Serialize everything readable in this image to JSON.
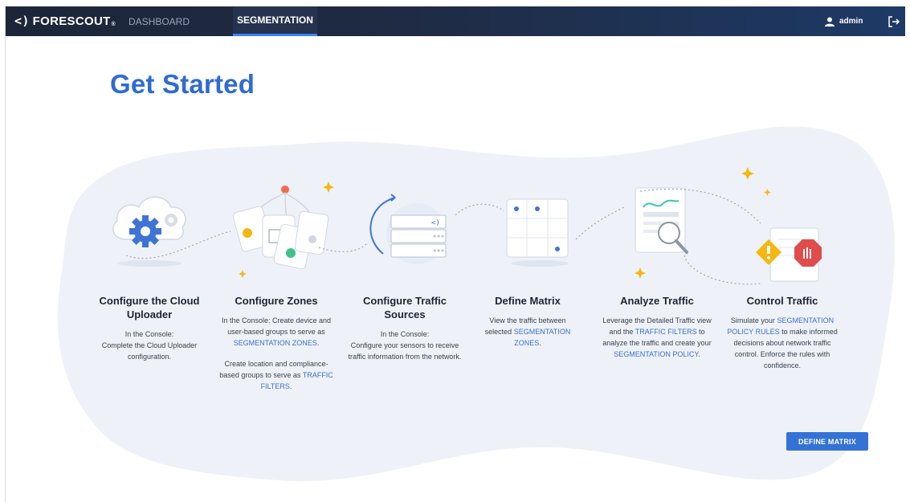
{
  "header": {
    "logo_mark": "<)",
    "logo_text": "FORESCOUT",
    "logo_reg": "®",
    "tabs": [
      {
        "label": "DASHBOARD",
        "active": false
      },
      {
        "label": "SEGMENTATION",
        "active": true
      }
    ],
    "user": "admin"
  },
  "page": {
    "title": "Get Started"
  },
  "steps": [
    {
      "title": "Configure the Cloud Uploader",
      "text1": "In the Console:",
      "text2": "Complete the Cloud Uploader configuration."
    },
    {
      "title": "Configure Zones",
      "text1": "In the Console: Create device and user-based groups to serve as",
      "link1": "SEGMENTATION ZONES",
      "after1": ".",
      "text2": "Create location and compliance-based groups to serve as",
      "link2": "TRAFFIC FILTERS",
      "after2": "."
    },
    {
      "title": "Configure Traffic Sources",
      "text1": "In the Console:",
      "text2": "Configure your sensors to receive traffic information from the network."
    },
    {
      "title": "Define Matrix",
      "text1": "View the traffic between selected",
      "link1": "SEGMENTATION ZONES",
      "after1": "."
    },
    {
      "title": "Analyze Traffic",
      "text1": "Leverage the Detailed Traffic view and the",
      "link1": "TRAFFIC FILTERS",
      "text2": "to analyze the traffic and create your",
      "link2": "SEGMENTATION POLICY",
      "after2": "."
    },
    {
      "title": "Control Traffic",
      "text1": "Simulate your",
      "link1": "SEGMENTATION POLICY RULES",
      "text2": "to make informed decisions about network traffic control. Enforce the rules with confidence."
    }
  ],
  "actions": {
    "define_matrix": "DEFINE MATRIX"
  },
  "colors": {
    "accent": "#2f6bd1",
    "link": "#3a6fcf",
    "topbar": "#1f2b44",
    "blob": "#eef2f8",
    "sparkle": "#f5b70f",
    "danger": "#e04b4b"
  }
}
